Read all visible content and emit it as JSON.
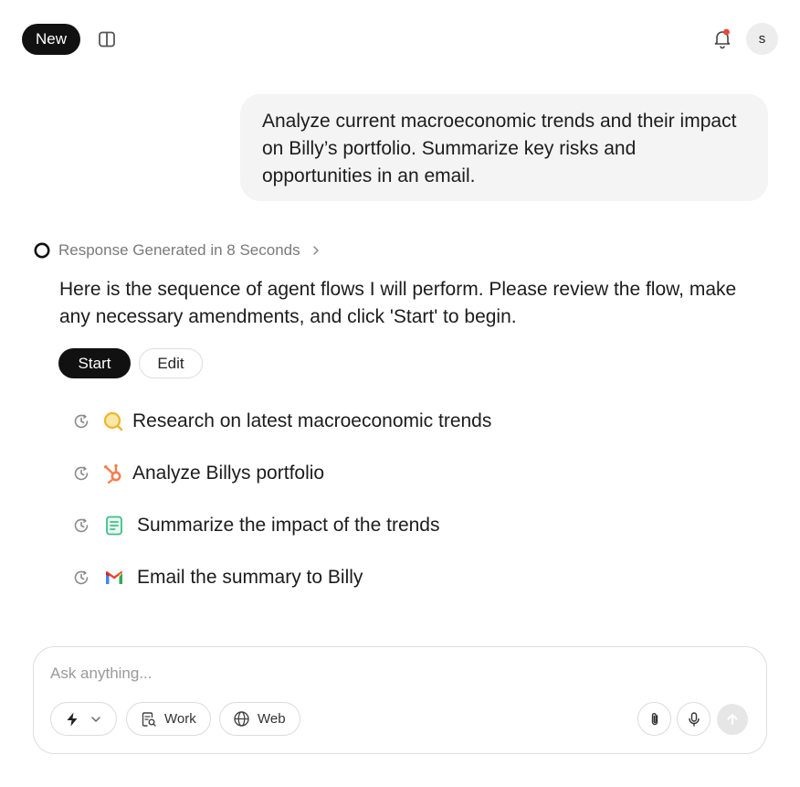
{
  "header": {
    "new_label": "New",
    "avatar_initial": "s",
    "notification_dot_color": "#e5483b"
  },
  "conversation": {
    "user_message": "Analyze current macroeconomic trends and their impact on Billy’s portfolio. Summarize key risks and opportunities in an email.",
    "response_meta": "Response Generated in 8 Seconds",
    "response_text": "Here is the sequence of agent flows I will perform. Please review the flow, make any necessary amendments, and click 'Start' to begin.",
    "start_label": "Start",
    "edit_label": "Edit",
    "steps": [
      {
        "label": "Research on latest macroeconomic trends",
        "icon": "search-icon"
      },
      {
        "label": "Analyze Billys portfolio",
        "icon": "hubspot-icon"
      },
      {
        "label": "Summarize the impact of the trends",
        "icon": "document-icon"
      },
      {
        "label": "Email the summary to Billy",
        "icon": "gmail-icon"
      }
    ]
  },
  "composer": {
    "placeholder": "Ask anything...",
    "value": "",
    "work_label": "Work",
    "web_label": "Web"
  },
  "colors": {
    "primary": "#111111",
    "bubble_bg": "#f4f4f4",
    "search_icon": "#f0b429",
    "hubspot_icon": "#f57f4f",
    "document_icon": "#3fbf8a"
  }
}
